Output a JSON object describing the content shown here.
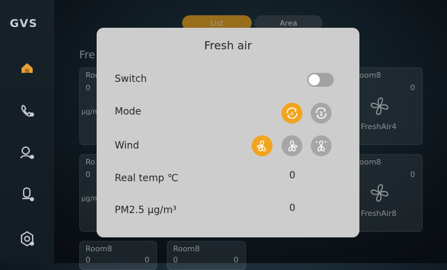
{
  "app": {
    "logo": "GVS"
  },
  "sidebar": {
    "items": [
      {
        "icon": "home-icon",
        "active": true
      },
      {
        "icon": "phone-icon",
        "active": false
      },
      {
        "icon": "security-icon",
        "active": false
      },
      {
        "icon": "settings-icon",
        "active": false
      },
      {
        "icon": "gear-icon",
        "active": false
      }
    ]
  },
  "tabs": [
    "List",
    "Area"
  ],
  "section_title": "Fre",
  "background_cards": [
    {
      "name": "Roo",
      "value": "0",
      "unit": "µg/m"
    },
    {
      "name": "oom8",
      "value_right": "0",
      "device": "FreshAir4"
    },
    {
      "name": "Ro",
      "value": "0",
      "unit": "µg/m"
    },
    {
      "name": "oom8",
      "value_right": "0",
      "device": "FreshAir8"
    },
    {
      "name": "Room8",
      "value": "0",
      "value_right": "0"
    },
    {
      "name": "Room8",
      "value": "0",
      "value_right": "0"
    }
  ],
  "dialog": {
    "title": "Fresh air",
    "switch": {
      "label": "Switch",
      "on": false
    },
    "mode": {
      "label": "Mode",
      "options": [
        "auto-mode-icon",
        "cycle-mode-icon"
      ],
      "selected": 0
    },
    "wind": {
      "label": "Wind",
      "options": [
        "fan-low-icon",
        "fan-medium-icon",
        "fan-high-icon"
      ],
      "selected": 0
    },
    "real_temp": {
      "label": "Real temp ℃",
      "value": "0"
    },
    "pm25": {
      "label": "PM2.5 µg/m³",
      "value": "0"
    }
  },
  "colors": {
    "accent": "#f1a41e",
    "dialog_bg": "#cdcdcd",
    "inactive": "#a6a6a6"
  }
}
